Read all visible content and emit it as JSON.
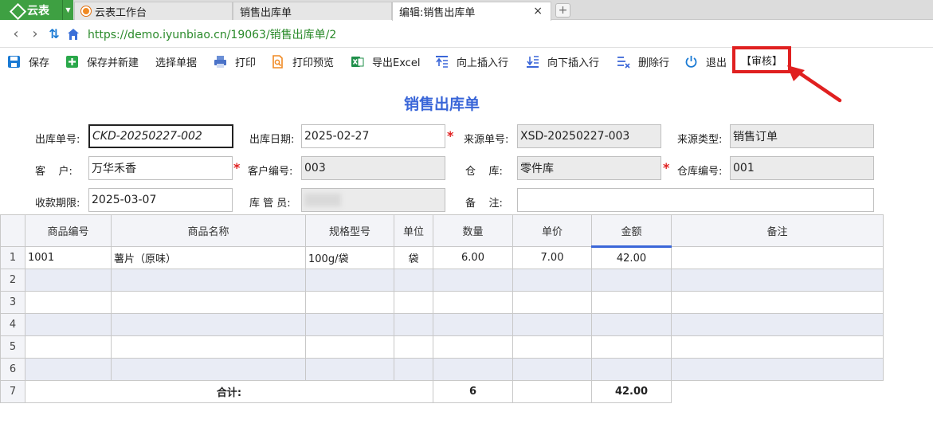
{
  "tabs": {
    "app_name": "云表",
    "items": [
      {
        "label": "云表工作台"
      },
      {
        "label": "销售出库单"
      },
      {
        "label": "编辑:销售出库单"
      }
    ],
    "close_glyph": "×",
    "add_glyph": "+"
  },
  "address": {
    "url": "https://demo.iyunbiao.cn/19063/销售出库单/2"
  },
  "toolbar": {
    "save": "保存",
    "save_new": "保存并新建",
    "select_doc": "选择单据",
    "print": "打印",
    "print_preview": "打印预览",
    "export_excel": "导出Excel",
    "insert_above": "向上插入行",
    "insert_below": "向下插入行",
    "delete_row": "删除行",
    "exit": "退出",
    "audit": "【审核】"
  },
  "form": {
    "title": "销售出库单",
    "out_no_label": "出库单号:",
    "out_no": "CKD-20250227-002",
    "out_date_label": "出库日期:",
    "out_date": "2025-02-27",
    "source_no_label": "来源单号:",
    "source_no": "XSD-20250227-003",
    "source_type_label": "来源类型:",
    "source_type": "销售订单",
    "customer_label": "客    户:",
    "customer": "万华禾香",
    "customer_no_label": "客户编号:",
    "customer_no": "003",
    "warehouse_label": "仓    库:",
    "warehouse": "零件库",
    "warehouse_no_label": "仓库编号:",
    "warehouse_no": "001",
    "pay_deadline_label": "收款期限:",
    "pay_deadline": "2025-03-07",
    "keeper_label": "库 管 员:",
    "remark_label": "备    注:",
    "remark": ""
  },
  "grid": {
    "columns": [
      "商品编号",
      "商品名称",
      "规格型号",
      "单位",
      "数量",
      "单价",
      "金额",
      "备注"
    ],
    "rows": [
      {
        "no": "1",
        "code": "1001",
        "name": "薯片（原味）",
        "spec": "100g/袋",
        "unit": "袋",
        "qty": "6.00",
        "price": "7.00",
        "amount": "42.00",
        "remark": ""
      },
      {
        "no": "2"
      },
      {
        "no": "3"
      },
      {
        "no": "4"
      },
      {
        "no": "5"
      },
      {
        "no": "6"
      }
    ],
    "total_row_no": "7",
    "total_label": "合计:",
    "total_qty": "6",
    "total_amount": "42.00"
  },
  "colors": {
    "brand_green": "#3ea042",
    "title_blue": "#3a66d8",
    "highlight_red": "#e02020"
  }
}
